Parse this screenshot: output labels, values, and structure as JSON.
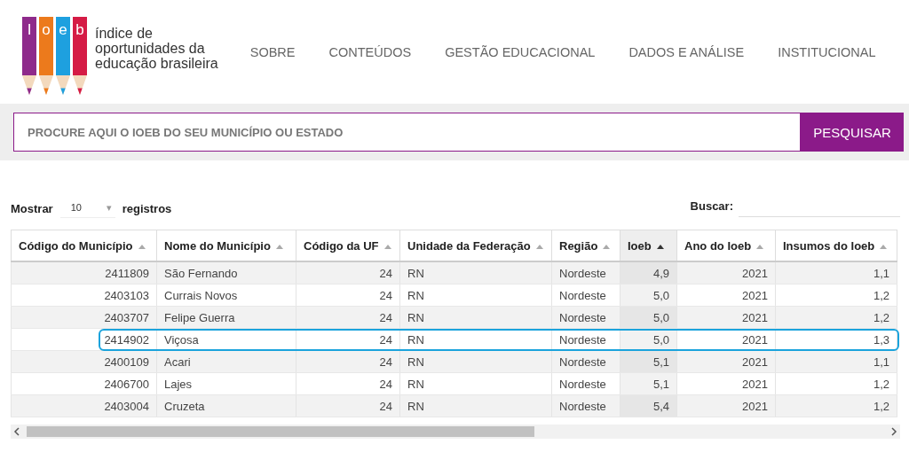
{
  "logo": {
    "letters": [
      {
        "char": "I",
        "color": "#8e2a8b"
      },
      {
        "char": "o",
        "color": "#ec7a1c"
      },
      {
        "char": "e",
        "color": "#1ea0df"
      },
      {
        "char": "b",
        "color": "#d51b45"
      }
    ],
    "tagline": [
      "índice de",
      "oportunidades da",
      "educação brasileira"
    ]
  },
  "nav": [
    "SOBRE",
    "CONTEÚDOS",
    "GESTÃO EDUCACIONAL",
    "DADOS E ANÁLISE",
    "INSTITUCIONAL"
  ],
  "search": {
    "placeholder": "PROCURE AQUI O IOEB DO SEU MUNICÍPIO OU ESTADO",
    "button": "PESQUISAR"
  },
  "length": {
    "label_before": "Mostrar",
    "value": "10",
    "caret": "▾",
    "label_after": "registros"
  },
  "filter": {
    "label": "Buscar:"
  },
  "table": {
    "columns": [
      {
        "label": "Código do Município",
        "kind": "number",
        "sorted": false
      },
      {
        "label": "Nome do Município",
        "kind": "text",
        "sorted": false
      },
      {
        "label": "Código da UF",
        "kind": "number",
        "sorted": false
      },
      {
        "label": "Unidade da Federação",
        "kind": "text",
        "sorted": false
      },
      {
        "label": "Região",
        "kind": "text",
        "sorted": false
      },
      {
        "label": "Ioeb",
        "kind": "number",
        "sorted": true
      },
      {
        "label": "Ano do Ioeb",
        "kind": "number",
        "sorted": false
      },
      {
        "label": "Insumos do Ioeb",
        "kind": "number",
        "sorted": false
      }
    ],
    "rows": [
      {
        "cells": [
          "2411809",
          "São Fernando",
          "24",
          "RN",
          "Nordeste",
          "4,9",
          "2021",
          "1,1"
        ],
        "highlighted": false
      },
      {
        "cells": [
          "2403103",
          "Currais Novos",
          "24",
          "RN",
          "Nordeste",
          "5,0",
          "2021",
          "1,2"
        ],
        "highlighted": false
      },
      {
        "cells": [
          "2403707",
          "Felipe Guerra",
          "24",
          "RN",
          "Nordeste",
          "5,0",
          "2021",
          "1,2"
        ],
        "highlighted": false
      },
      {
        "cells": [
          "2414902",
          "Viçosa",
          "24",
          "RN",
          "Nordeste",
          "5,0",
          "2021",
          "1,3"
        ],
        "highlighted": true
      },
      {
        "cells": [
          "2400109",
          "Acari",
          "24",
          "RN",
          "Nordeste",
          "5,1",
          "2021",
          "1,1"
        ],
        "highlighted": false
      },
      {
        "cells": [
          "2406700",
          "Lajes",
          "24",
          "RN",
          "Nordeste",
          "5,1",
          "2021",
          "1,2"
        ],
        "highlighted": false
      },
      {
        "cells": [
          "2403004",
          "Cruzeta",
          "24",
          "RN",
          "Nordeste",
          "5,4",
          "2021",
          "1,2"
        ],
        "highlighted": false
      }
    ]
  }
}
